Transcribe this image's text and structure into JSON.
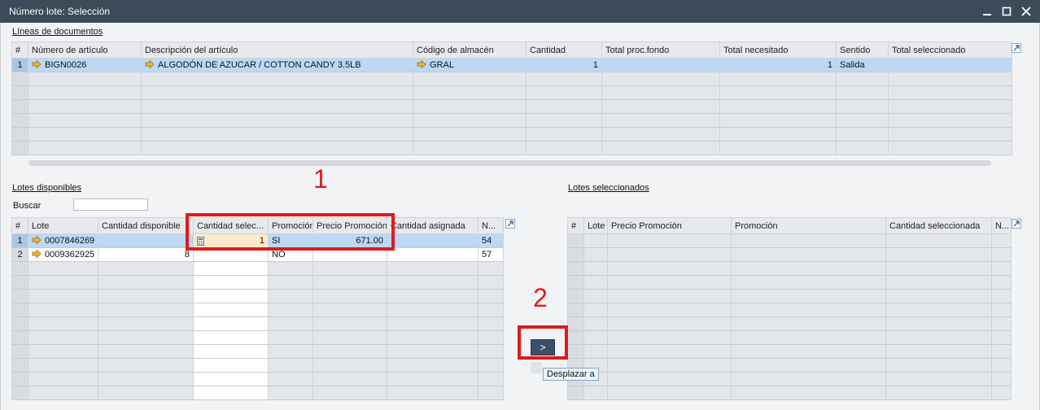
{
  "window": {
    "title": "Número lote: Selección"
  },
  "doc_lines": {
    "label": "Líneas de documentos",
    "columns": [
      "#",
      "Número de artículo",
      "Descripción del artículo",
      "Código de almacén",
      "Cantidad",
      "Total proc.fondo",
      "Total necesitado",
      "Sentido",
      "Total seleccionado"
    ],
    "rows": [
      {
        "n": "1",
        "item": "BIGN0026",
        "desc": "ALGODÓN DE AZUCAR / COTTON CANDY 3.5LB",
        "wh": "GRAL",
        "qty": "1",
        "proc": "",
        "needed": "1",
        "dir": "Salida",
        "selected": ""
      }
    ]
  },
  "available": {
    "label": "Lotes disponibles",
    "search_label": "Buscar",
    "search_value": "",
    "columns": [
      "#",
      "Lote",
      "Cantidad disponible",
      "Cantidad selec...",
      "Promoción",
      "Precio Promoción",
      "Cantidad asignada",
      "N..."
    ],
    "rows": [
      {
        "n": "1",
        "lot": "0007846269",
        "avail": "",
        "sel": "1",
        "promo": "SI",
        "price": "671.00",
        "assigned": "",
        "nn": "54"
      },
      {
        "n": "2",
        "lot": "0009362925",
        "avail": "8",
        "sel": "",
        "promo": "NO",
        "price": "",
        "assigned": "",
        "nn": "57"
      }
    ]
  },
  "selected": {
    "label": "Lotes seleccionados",
    "columns": [
      "#",
      "Lote",
      "Precio Promoción",
      "Promoción",
      "Cantidad seleccionada",
      "N..."
    ]
  },
  "move_button": {
    "label": ">",
    "tooltip": "Desplazar a"
  },
  "annotations": {
    "step1": "1",
    "step2": "2",
    "color": "#e01b1b"
  },
  "icons": {
    "row_link": "orange-arrow-icon",
    "expand": "expand-arrow-icon",
    "calculator": "calculator-icon"
  }
}
